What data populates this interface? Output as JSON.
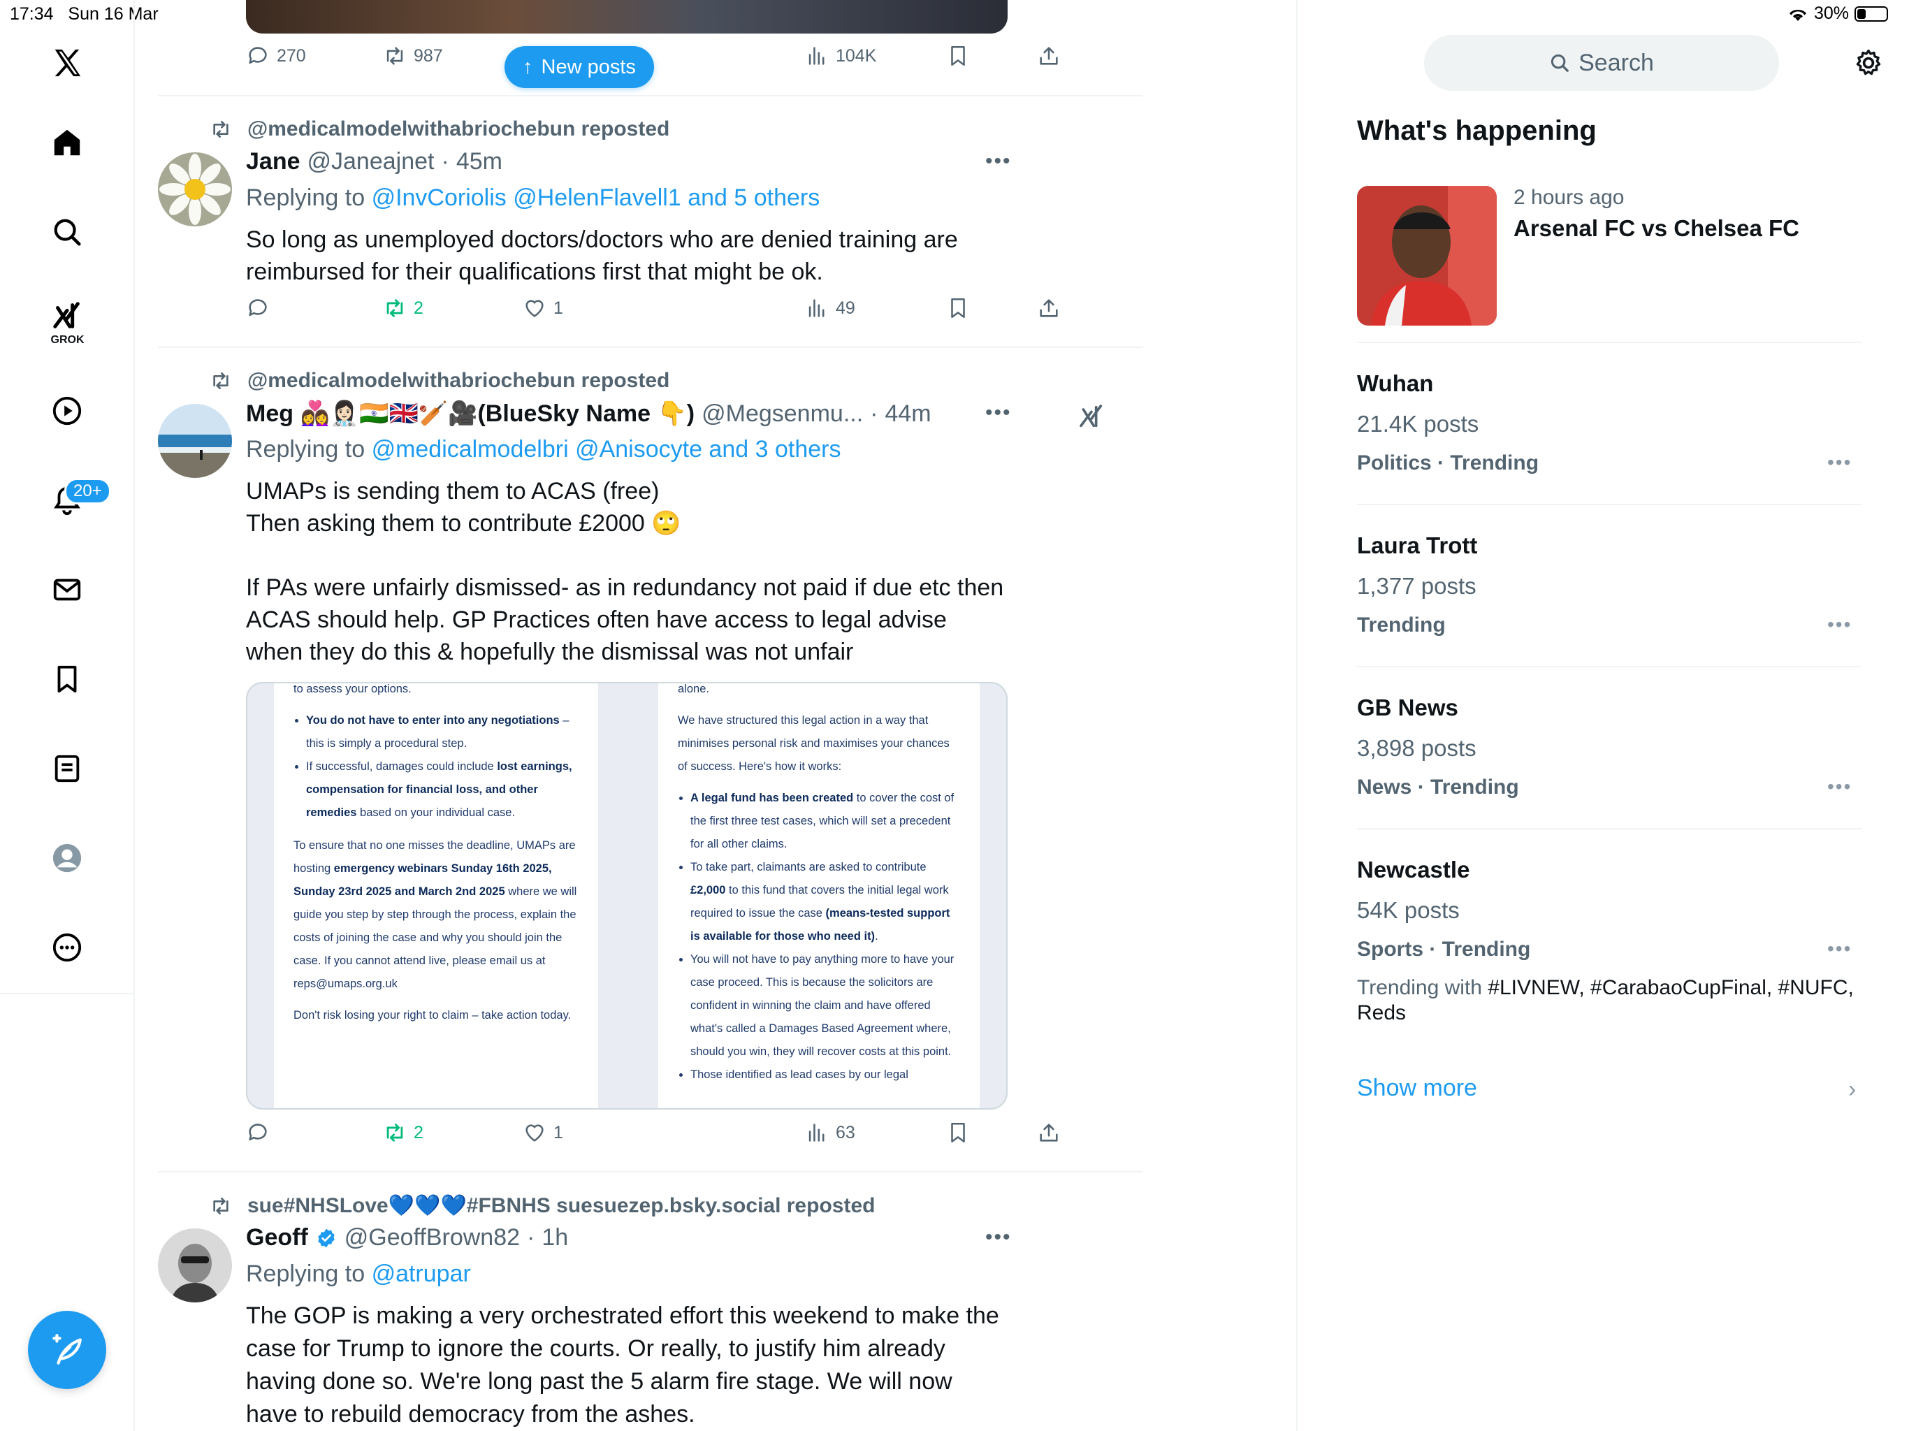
{
  "status_bar": {
    "time": "17:34",
    "date": "Sun 16 Mar",
    "battery": "30%",
    "battery_level": 0.3
  },
  "nav": {
    "items": [
      "Home",
      "Explore",
      "Grok",
      "Video",
      "Notifications",
      "Messages",
      "Bookmarks",
      "Lists",
      "Profile",
      "More"
    ],
    "grok_label": "GROK",
    "notification_badge": "20+"
  },
  "top_post_actions": {
    "replies": "270",
    "reposts": "987",
    "views": "104K"
  },
  "new_posts_label": "New posts",
  "posts": [
    {
      "reposted_by": "@medicalmodelwithabriochebun reposted",
      "name": "Jane",
      "handle": "@Janeajnet",
      "time": "45m",
      "replying_prefix": "Replying to",
      "replying_to": "@InvCoriolis @HelenFlavell1 and 5 others",
      "text": "So long as unemployed doctors/doctors who are denied training are reimbursed for their qualifications first that might be ok.",
      "reposts": "2",
      "likes": "1",
      "views": "49"
    },
    {
      "reposted_by": "@medicalmodelwithabriochebun reposted",
      "name": "Meg 👩‍❤️‍👩👩🏻‍⚕️🇮🇳🇬🇧🏏🎥(BlueSky Name 👇)",
      "handle": "@Megsenmu...",
      "time": "44m",
      "replying_prefix": "Replying to",
      "replying_to": "@medicalmodelbri @Anisocyte and 3 others",
      "text": "UMAPs is sending them to ACAS (free)\nThen asking them to contribute £2000 🙄\n\nIf PAs were unfairly dismissed- as in redundancy not paid if due etc then ACAS should help. GP Practices often have access to legal advise when they do this & hopefully the dismissal was not unfair",
      "reposts": "2",
      "likes": "1",
      "views": "63",
      "media_left": {
        "l0": "to assess your options.",
        "b1_a": "You do not have to enter into any negotiations",
        "b1_b": " – this is simply a procedural step.",
        "b2_a": "If successful, damages could include ",
        "b2_b": "lost earnings, compensation for financial loss, and other remedies",
        "b2_c": " based on your individual case.",
        "p1_a": "To ensure that no one misses the deadline, UMAPs are hosting ",
        "p1_b": "emergency webinars Sunday 16th 2025, Sunday 23rd 2025 and March 2nd 2025",
        "p1_c": " where we will guide you step by step through the process, explain the costs of joining the case and why you should join the case. If you cannot attend live, please email us at reps@umaps.org.uk",
        "p2": "Don't risk losing your right to claim – take action today."
      },
      "media_right": {
        "l0": "alone.",
        "p1": "We have structured this legal action in a way that minimises personal risk and maximises your chances of success. Here's how it works:",
        "b1_a": "A legal fund has been created",
        "b1_b": " to cover the cost of the first three test cases, which will set a precedent for all other claims.",
        "b2_a": "To take part, claimants are asked to contribute ",
        "b2_b": "£2,000",
        "b2_c": " to this fund that covers the initial legal work required to issue the case ",
        "b2_d": "(means-tested support is available for those who need it)",
        "b2_e": ".",
        "b3": "You will not have to pay anything more to have your case proceed. This is because the solicitors are confident in winning the claim and have offered what's called a Damages Based Agreement where, should you win, they will recover costs at this point.",
        "b4": "Those identified as lead cases by our legal"
      }
    },
    {
      "reposted_by": "sue#NHSLove💙💙💙#FBNHS suesuezep.bsky.social reposted",
      "name": "Geoff",
      "handle": "@GeoffBrown82",
      "time": "1h",
      "replying_prefix": "Replying to",
      "replying_to": "@atrupar",
      "text": "The GOP is making a very orchestrated effort this weekend to make the case for Trump to ignore the courts. Or really, to justify him already having done so. We're long past the 5 alarm fire stage. We will now have to rebuild democracy from the ashes."
    }
  ],
  "right": {
    "search_placeholder": "Search",
    "section_title": "What's happening",
    "featured": {
      "time": "2 hours ago",
      "headline": "Arsenal FC vs Chelsea FC"
    },
    "trends": [
      {
        "name": "Wuhan",
        "count": "21.4K posts",
        "category": "Politics · Trending"
      },
      {
        "name": "Laura Trott",
        "count": "1,377 posts",
        "category": "Trending"
      },
      {
        "name": "GB News",
        "count": "3,898 posts",
        "category": "News · Trending"
      },
      {
        "name": "Newcastle",
        "count": "54K posts",
        "category": "Sports · Trending",
        "with_prefix": "Trending with ",
        "with_tags": "#LIVNEW, #CarabaoCupFinal, #NUFC,",
        "with_tail": "Reds"
      }
    ],
    "show_more": "Show more"
  },
  "colors": {
    "accent": "#1d9bf0",
    "secondary_text": "#536471",
    "repost_green": "#00ba7c",
    "divider": "#eff3f4"
  }
}
